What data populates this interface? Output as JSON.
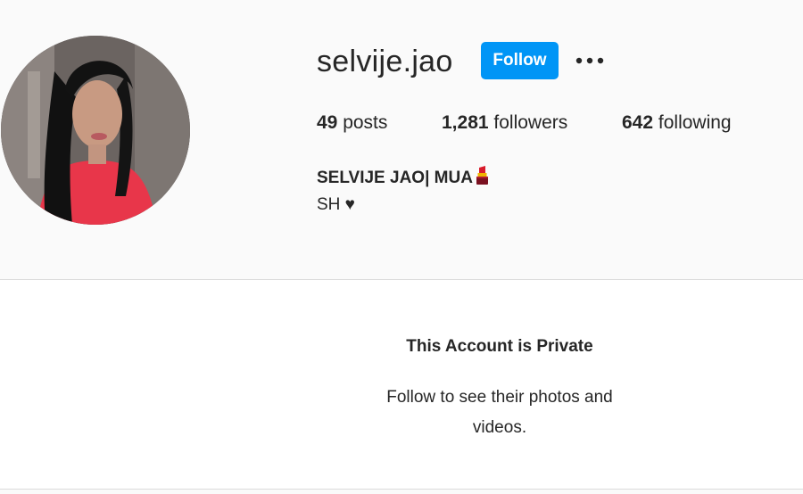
{
  "profile": {
    "username": "selvije.jao",
    "follow_label": "Follow",
    "more_options_icon": "more-horizontal-icon",
    "stats": {
      "posts_count": "49",
      "posts_label": "posts",
      "followers_count": "1,281",
      "followers_label": "followers",
      "following_count": "642",
      "following_label": "following"
    },
    "full_name": "SELVIJE JAO| MUA",
    "full_name_emoji_icon": "lipstick-icon",
    "bio": "SH ♥"
  },
  "private_notice": {
    "title": "This Account is Private",
    "subtitle": "Follow to see their photos and videos."
  },
  "colors": {
    "accent": "#0095f6",
    "text": "#262626",
    "background": "#fafafa",
    "divider": "#dbdbdb"
  }
}
